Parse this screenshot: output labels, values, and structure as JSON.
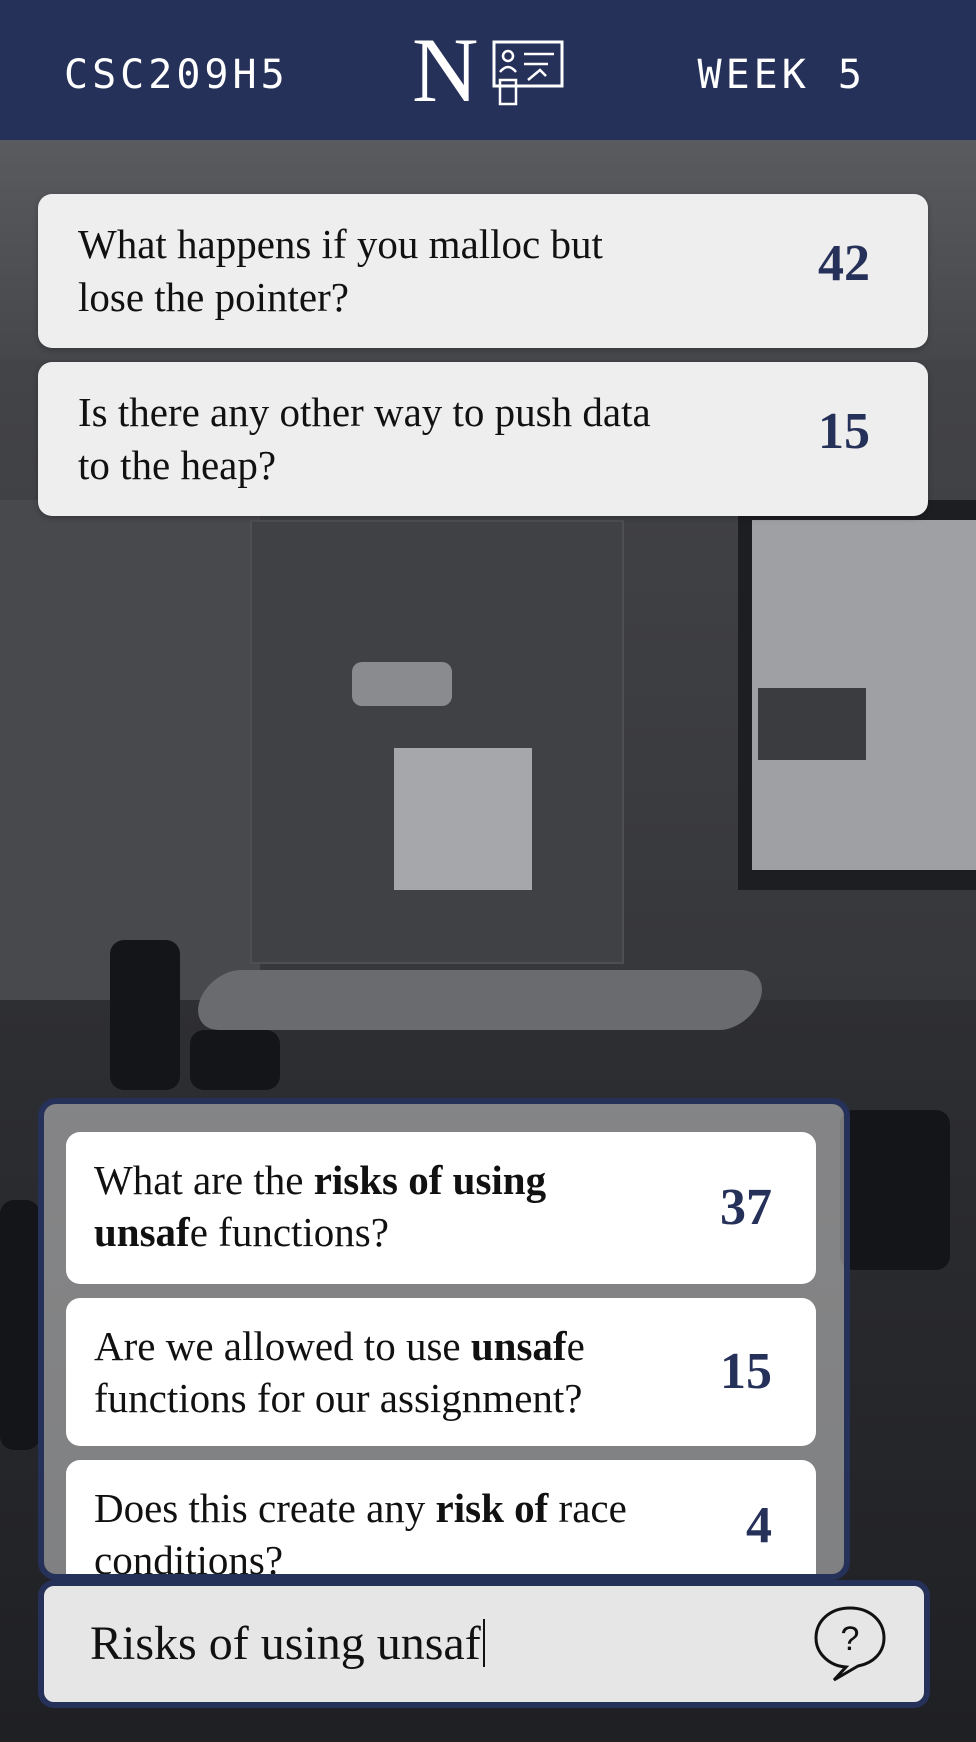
{
  "header": {
    "course": "CSC209H5",
    "week": "WEEK 5",
    "logo_letter": "N",
    "logo_icon": "presentation-board-icon",
    "background_color": "#263159"
  },
  "questions": [
    {
      "text": "What happens if you malloc but lose the pointer?",
      "votes": "42"
    },
    {
      "text": "Is there any other way to push data to the heap?",
      "votes": "15"
    }
  ],
  "suggestions": [
    {
      "parts": [
        {
          "text": "What are the ",
          "bold": false
        },
        {
          "text": "risks of using unsaf",
          "bold": true
        },
        {
          "text": "e functions?",
          "bold": false
        }
      ],
      "votes": "37"
    },
    {
      "parts": [
        {
          "text": "Are we allowed to use ",
          "bold": false
        },
        {
          "text": "unsaf",
          "bold": true
        },
        {
          "text": "e functions for our assignment?",
          "bold": false
        }
      ],
      "votes": "15"
    },
    {
      "parts": [
        {
          "text": "Does this create any ",
          "bold": false
        },
        {
          "text": "risk of",
          "bold": true
        },
        {
          "text": " race conditions?",
          "bold": false
        }
      ],
      "votes": "4"
    }
  ],
  "input": {
    "value": "Risks of using unsaf",
    "help_icon": "question-bubble-icon"
  },
  "colors": {
    "accent": "#263159",
    "card": "#eeeeee"
  }
}
